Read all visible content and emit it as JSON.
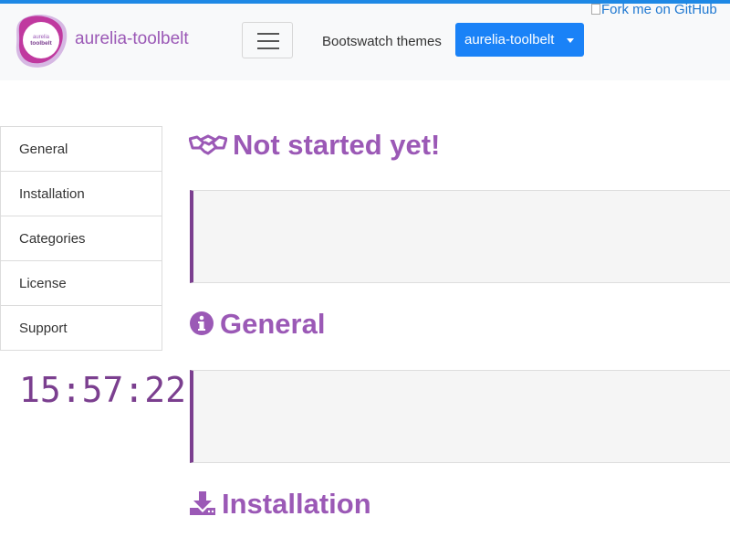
{
  "navbar": {
    "brand_logo_text_top": "aurelia",
    "brand_logo_text_bottom": "toolbelt",
    "brand_name": "aurelia-toolbelt",
    "themes_label": "Bootswatch themes",
    "theme_button_label": "aurelia-toolbelt",
    "fork_ribbon_alt": "Fork me on GitHub"
  },
  "sidebar": {
    "items": [
      {
        "label": "General"
      },
      {
        "label": "Installation"
      },
      {
        "label": "Categories"
      },
      {
        "label": "License"
      },
      {
        "label": "Support"
      }
    ]
  },
  "clock": "15:57:22",
  "sections": [
    {
      "title": "Not started yet!",
      "icon": "handshake-icon"
    },
    {
      "title": "General",
      "icon": "info-circle-icon"
    },
    {
      "title": "Installation",
      "icon": "download-icon"
    }
  ],
  "colors": {
    "accent": "#9b59b6",
    "accent_dark": "#7b3f8f",
    "primary_button": "#1a82f7",
    "top_bar": "#1e88e5"
  }
}
